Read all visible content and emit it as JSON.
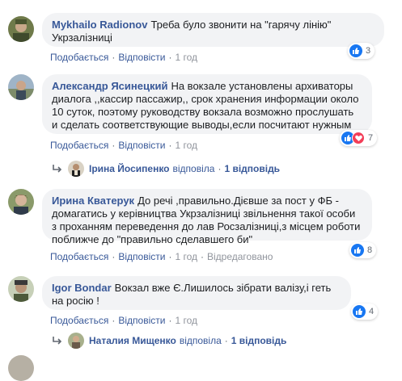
{
  "comments": [
    {
      "author": "Mykhailo Radionov",
      "text": "Треба було звонити на \"гарячу лінію\" Укрзалізниці",
      "like": "Подобається",
      "reply": "Відповісти",
      "time": "1 год",
      "reactions": "3"
    },
    {
      "author": "Александр Ясинецкий",
      "text": "На вокзале установлены архиваторы диалога ,,кассир пассажир,, срок хранения информации около 10 суток, поэтому руководству вокзала возможно прослушать и сделать соответствующие выводы,если посчитают нужным",
      "like": "Подобається",
      "reply": "Відповісти",
      "time": "1 год",
      "reactions": "7"
    },
    {
      "author": "Ирина Кватерук",
      "text": "До речі ,правильно.Дієвше за пост у ФБ - домагатись у керівництва Укрзалізниці звільнення такої особи з проханням переведення до лав Росзалізниці,з місцем роботи поближче до \"правильно сделавшего би\"",
      "like": "Подобається",
      "reply": "Відповісти",
      "time": "1 год",
      "edited": "Відредаговано",
      "reactions": "8"
    },
    {
      "author": "Igor Bondar",
      "text": "Вокзал вже Є.Лишилось зібрати валізу,і геть на росію !",
      "like": "Подобається",
      "reply": "Відповісти",
      "time": "1 год",
      "reactions": "4"
    }
  ],
  "reply_threads": [
    {
      "name": "Ірина Йосипенко",
      "action": "відповіла",
      "count": "1 відповідь"
    },
    {
      "name": "Наталия Мищенко",
      "action": "відповіла",
      "count": "1 відповідь"
    }
  ],
  "colors": {
    "link": "#385898",
    "bubble": "#f2f3f5",
    "like": "#1877f2",
    "love": "#f33e58"
  },
  "icons": [
    "avatar",
    "like-icon",
    "love-icon",
    "reply-arrow-icon"
  ]
}
